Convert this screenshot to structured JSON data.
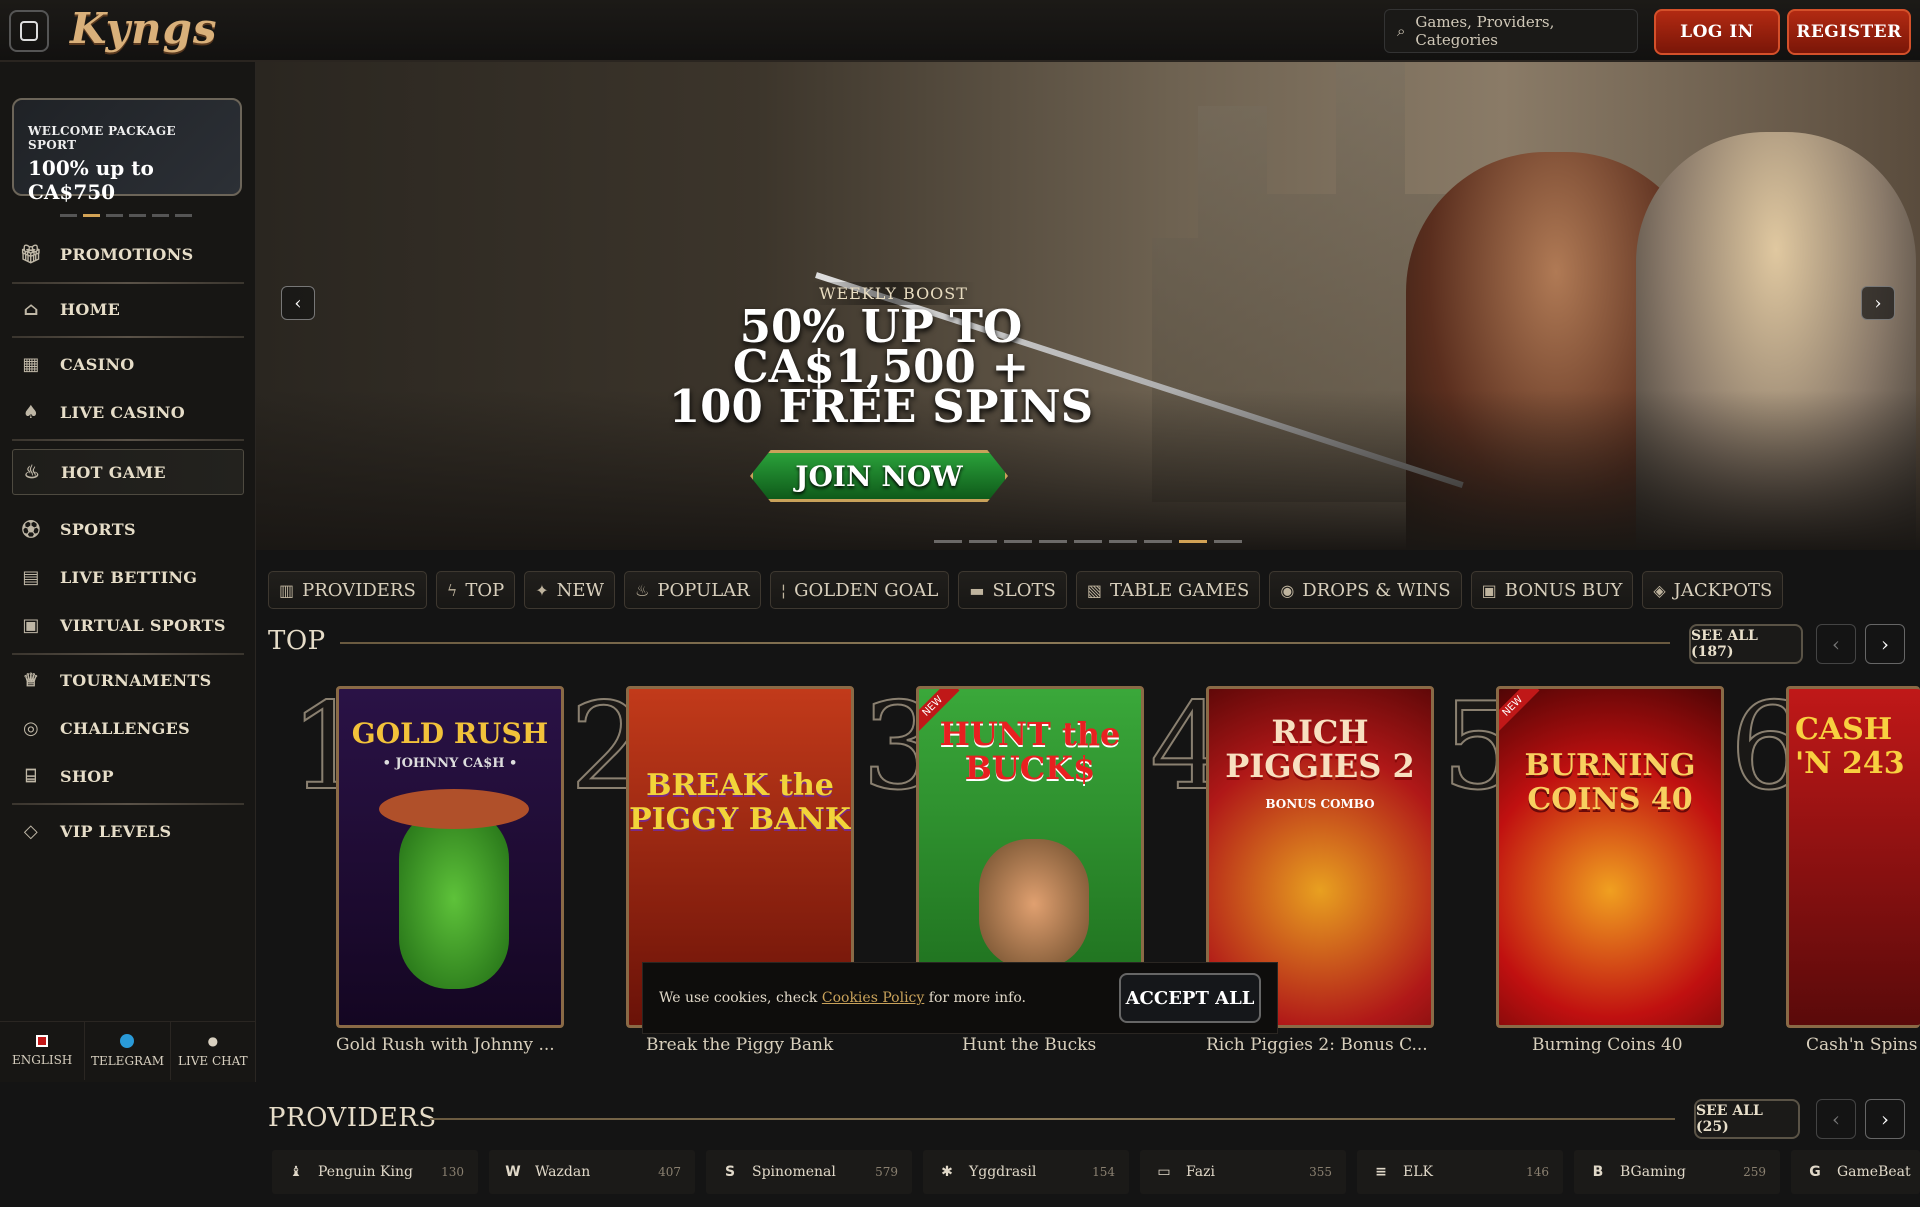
{
  "header": {
    "logo_text": "Kyngs",
    "search_placeholder": "Games, Providers, Categories",
    "login_label": "LOG IN",
    "register_label": "REGISTER"
  },
  "sidebar": {
    "welcome_small": "WELCOME PACKAGE SPORT",
    "welcome_big": "100% up to CA$750",
    "items": [
      {
        "label": "PROMOTIONS",
        "icon": "gift-icon"
      },
      {
        "label": "HOME",
        "icon": "home-icon"
      },
      {
        "label": "CASINO",
        "icon": "casino-icon"
      },
      {
        "label": "LIVE CASINO",
        "icon": "cards-icon"
      },
      {
        "label": "HOT GAME",
        "icon": "flame-icon"
      },
      {
        "label": "SPORTS",
        "icon": "ball-icon"
      },
      {
        "label": "LIVE BETTING",
        "icon": "live-icon"
      },
      {
        "label": "VIRTUAL SPORTS",
        "icon": "virtual-icon"
      },
      {
        "label": "TOURNAMENTS",
        "icon": "trophy-icon"
      },
      {
        "label": "CHALLENGES",
        "icon": "target-icon"
      },
      {
        "label": "SHOP",
        "icon": "shop-icon"
      },
      {
        "label": "VIP LEVELS",
        "icon": "diamond-icon"
      }
    ],
    "footer": {
      "english": "ENGLISH",
      "telegram": "TELEGRAM",
      "live_chat": "LIVE CHAT"
    }
  },
  "hero": {
    "tag": "WEEKLY BOOST",
    "title_line1": "50% UP TO CA$1,500 +",
    "title_line2": "100 FREE SPINS",
    "cta": "JOIN NOW"
  },
  "categories": [
    {
      "label": "PROVIDERS",
      "icon": "book-icon"
    },
    {
      "label": "TOP",
      "icon": "bolt-icon"
    },
    {
      "label": "NEW",
      "icon": "star-icon"
    },
    {
      "label": "POPULAR",
      "icon": "flame-icon"
    },
    {
      "label": "GOLDEN GOAL",
      "icon": "torch-icon"
    },
    {
      "label": "SLOTS",
      "icon": "slots-icon"
    },
    {
      "label": "TABLE GAMES",
      "icon": "table-icon"
    },
    {
      "label": "DROPS & WINS",
      "icon": "drops-icon"
    },
    {
      "label": "BONUS BUY",
      "icon": "gift-icon"
    },
    {
      "label": "JACKPOTS",
      "icon": "jackpot-icon"
    }
  ],
  "top": {
    "title": "TOP",
    "see_all": "SEE ALL (187)",
    "games": [
      {
        "rank": "1",
        "name": "Gold Rush with Johnny ...",
        "art_title": "GOLD RUSH",
        "art_sub": "• JOHNNY CA$H •",
        "new": false
      },
      {
        "rank": "2",
        "name": "Break the Piggy Bank",
        "art_title": "BREAK the PIGGY BANK",
        "art_sub": "",
        "new": false
      },
      {
        "rank": "3",
        "name": "Hunt the Bucks",
        "art_title": "HUNT the BUCK$",
        "art_sub": "",
        "new": true
      },
      {
        "rank": "4",
        "name": "Rich Piggies 2: Bonus C...",
        "art_title": "RICH PIGGIES 2",
        "art_sub": "BONUS COMBO",
        "new": false
      },
      {
        "rank": "5",
        "name": "Burning Coins 40",
        "art_title": "BURNING COINS 40",
        "art_sub": "",
        "new": true
      },
      {
        "rank": "6",
        "name": "Cash'n Spins",
        "art_title": "CASH 'N 243",
        "art_sub": "",
        "new": false
      }
    ],
    "new_badge": "NEW"
  },
  "cookie": {
    "text_before": "We use cookies, check ",
    "link": "Cookies Policy",
    "text_after": " for more info.",
    "accept": "ACCEPT ALL"
  },
  "providers": {
    "title": "PROVIDERS",
    "see_all": "SEE ALL (25)",
    "items": [
      {
        "name": "Penguin King",
        "count": "130"
      },
      {
        "name": "Wazdan",
        "count": "407"
      },
      {
        "name": "Spinomenal",
        "count": "579"
      },
      {
        "name": "Yggdrasil",
        "count": "154"
      },
      {
        "name": "Fazi",
        "count": "355"
      },
      {
        "name": "ELK",
        "count": "146"
      },
      {
        "name": "BGaming",
        "count": "259"
      },
      {
        "name": "GameBeat",
        "count": ""
      }
    ]
  },
  "colors": {
    "accent_gold": "#d2a255",
    "register_red": "#b22a12",
    "cta_green": "#2aa13a"
  }
}
